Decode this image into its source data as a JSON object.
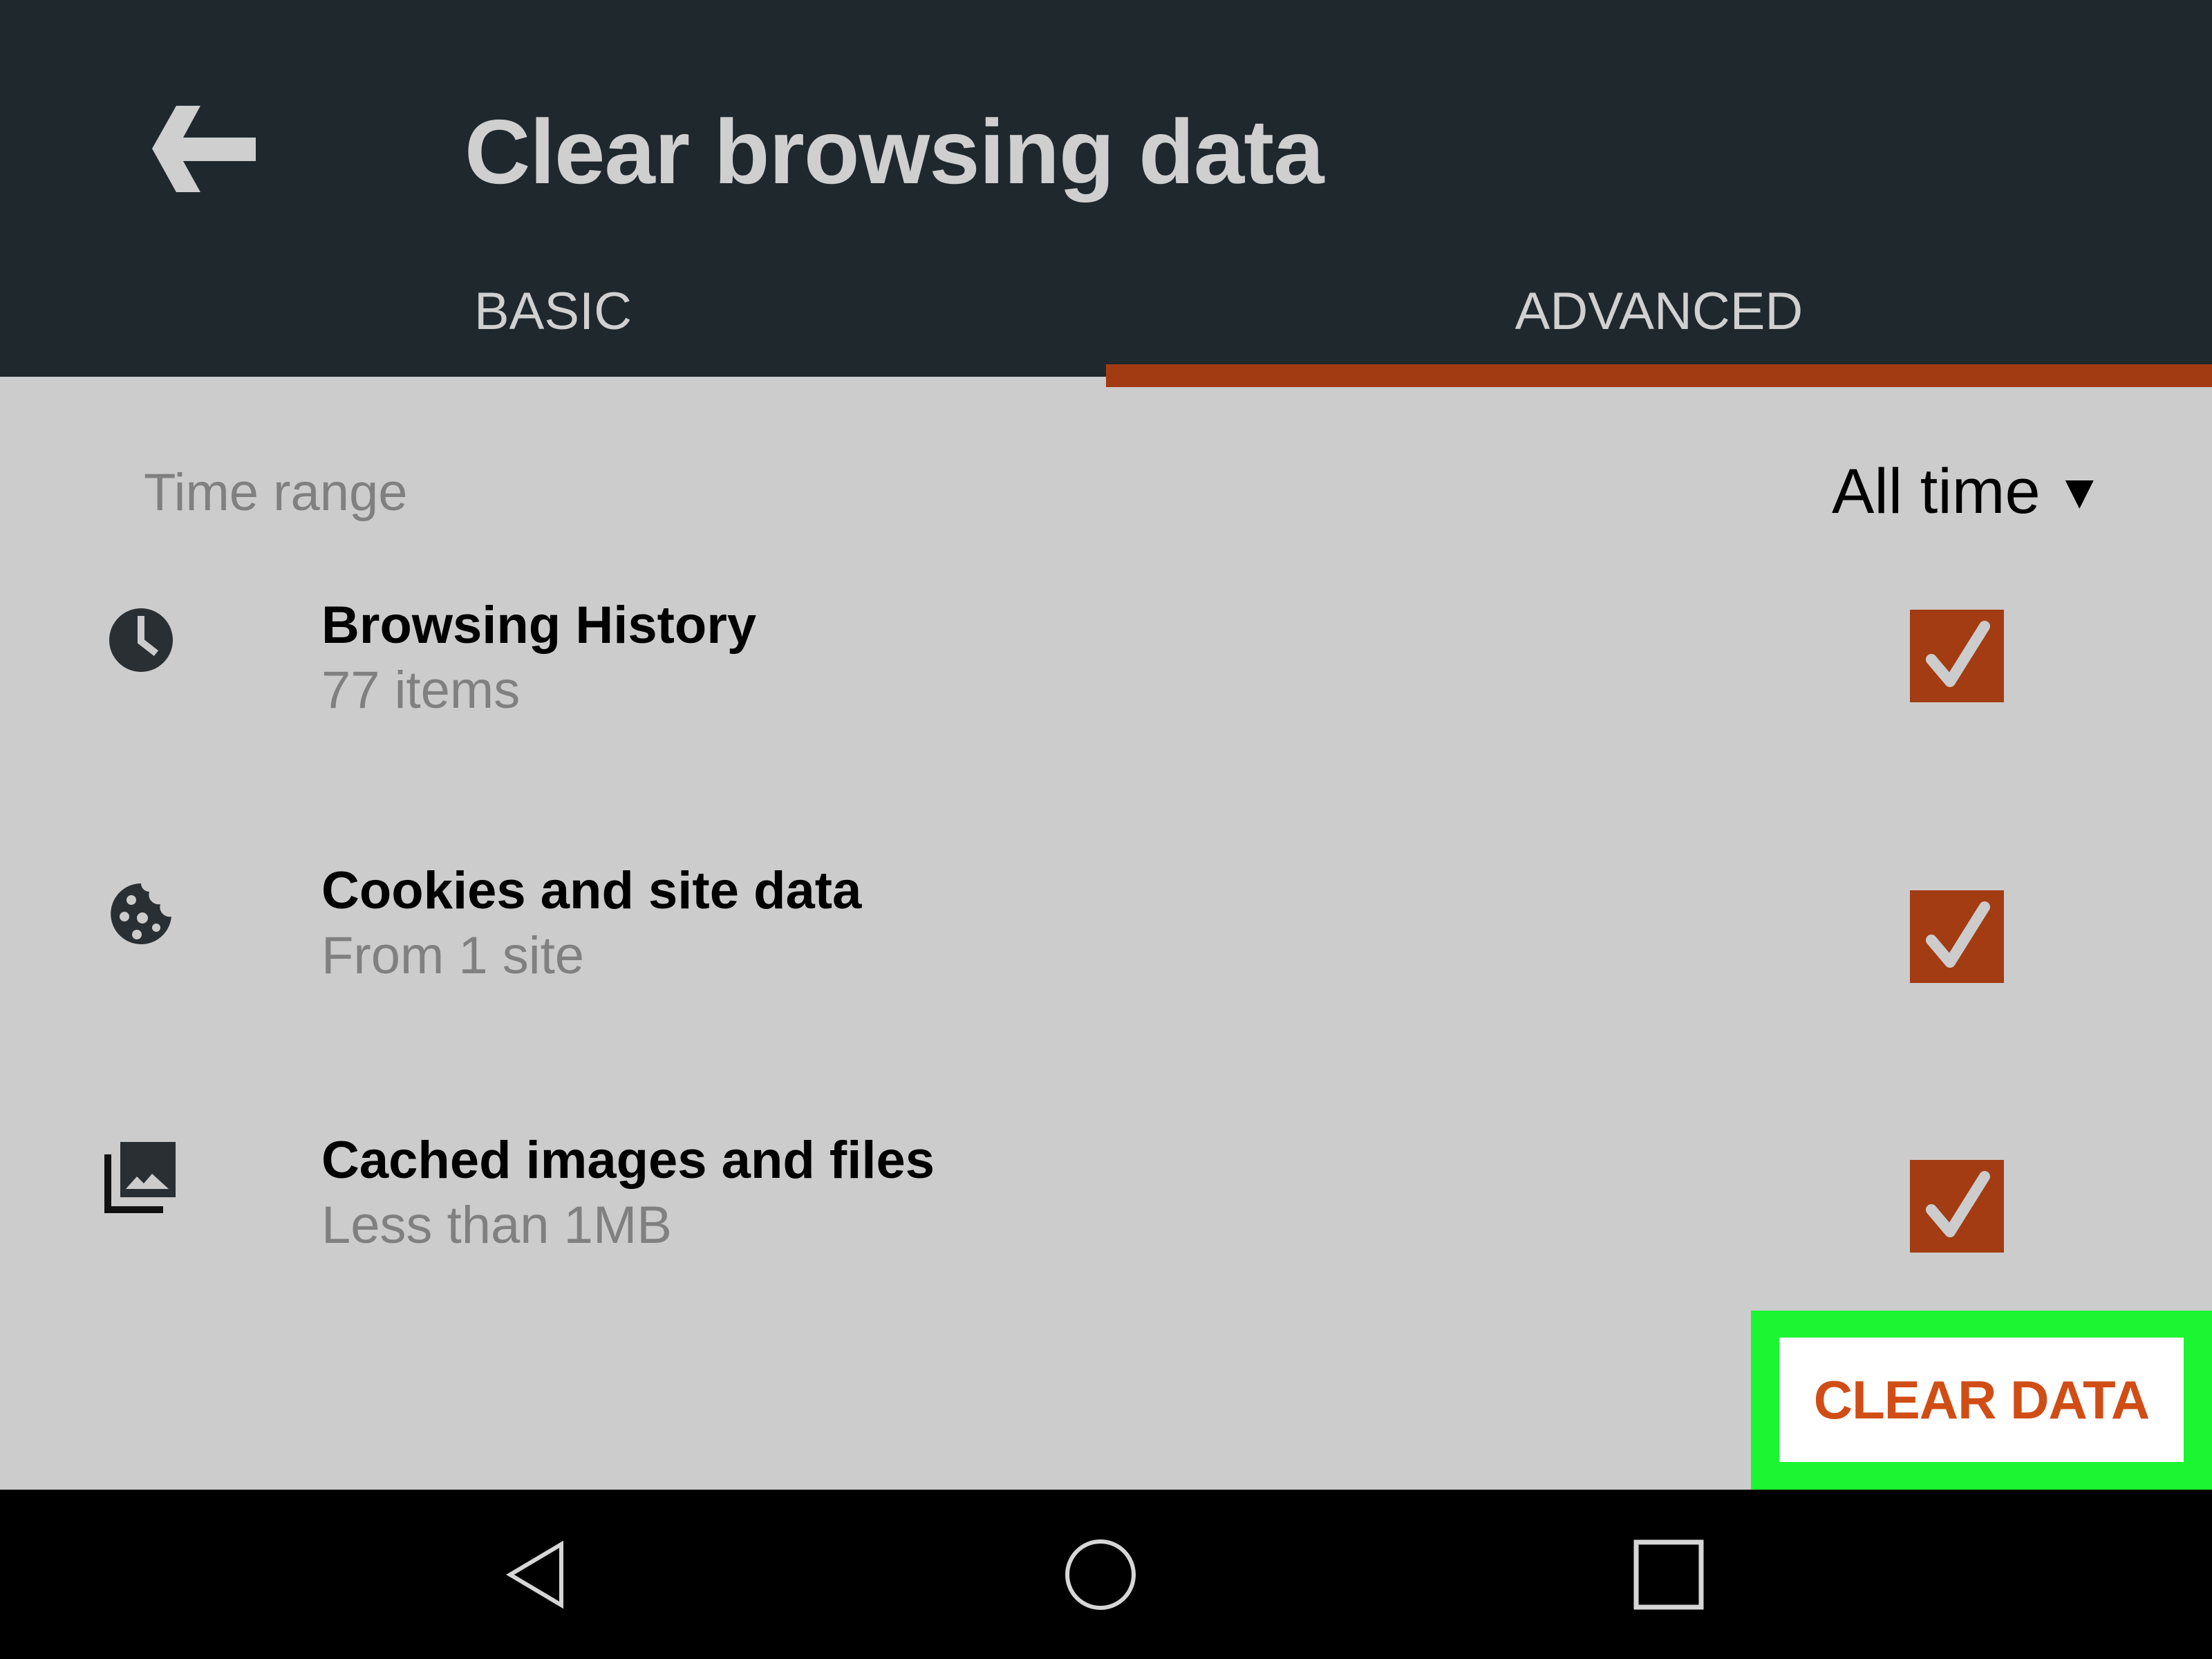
{
  "header": {
    "title": "Clear browsing data",
    "back_icon": "arrow-left-icon"
  },
  "tabs": [
    {
      "label": "BASIC",
      "active": false
    },
    {
      "label": "ADVANCED",
      "active": true
    }
  ],
  "time_range": {
    "label": "Time range",
    "selected": "All time",
    "caret": "▼"
  },
  "items": [
    {
      "title": "Browsing History",
      "subtitle": "77 items",
      "icon": "clock-icon",
      "checked": true
    },
    {
      "title": "Cookies and site data",
      "subtitle": "From 1 site",
      "icon": "cookie-icon",
      "checked": true
    },
    {
      "title": "Cached images and files",
      "subtitle": "Less than 1MB",
      "icon": "image-stack-icon",
      "checked": true
    }
  ],
  "clear_button": {
    "label": "CLEAR DATA",
    "highlight_color": "#1cf531"
  },
  "navbar": {
    "back": "nav-back-icon",
    "home": "nav-home-icon",
    "recents": "nav-recents-icon"
  },
  "colors": {
    "header_bg": "#1f282d",
    "accent": "#a33c12",
    "content_bg": "#cccccc",
    "button_text": "#d14d16"
  }
}
